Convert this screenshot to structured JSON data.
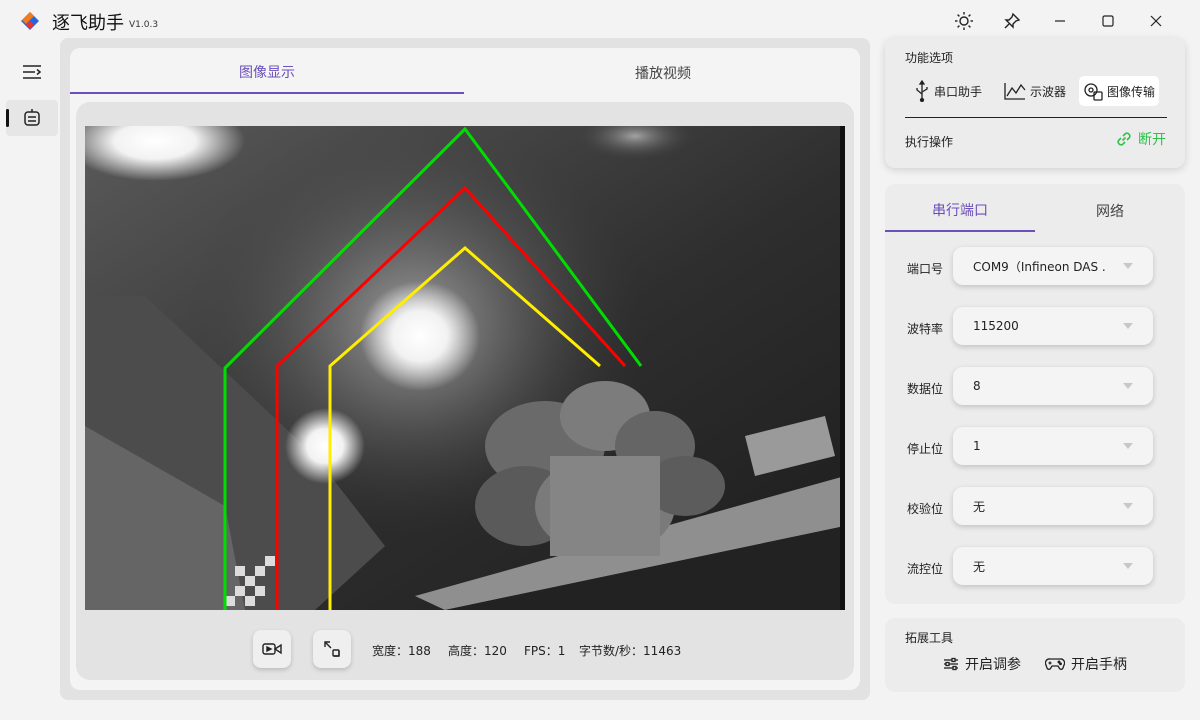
{
  "app": {
    "title": "逐飞助手",
    "version": "V1.0.3"
  },
  "content": {
    "tabs": [
      {
        "label": "图像显示",
        "active": true
      },
      {
        "label": "播放视频",
        "active": false
      }
    ],
    "stats": {
      "width_label": "宽度：",
      "width": "188",
      "height_label": "高度：",
      "height": "120",
      "fps_label": "FPS：",
      "fps": "1",
      "bytes_label": "字节数/秒：",
      "bytes": "11463"
    },
    "overlay_colors": {
      "outer": "#00dd00",
      "middle": "#ff0000",
      "inner": "#ffee00"
    }
  },
  "function_panel": {
    "title": "功能选项",
    "buttons": [
      {
        "label": "串口助手",
        "icon": "usb-icon",
        "active": false
      },
      {
        "label": "示波器",
        "icon": "oscilloscope-icon",
        "active": false
      },
      {
        "label": "图像传输",
        "icon": "image-transfer-icon",
        "active": true
      }
    ],
    "action_label": "执行操作",
    "disconnect_label": "断开"
  },
  "connection_panel": {
    "tabs": [
      {
        "label": "串行端口",
        "active": true
      },
      {
        "label": "网络",
        "active": false
      }
    ],
    "fields": [
      {
        "label": "端口号",
        "value": "COM9（Infineon DAS ."
      },
      {
        "label": "波特率",
        "value": "115200"
      },
      {
        "label": "数据位",
        "value": "8"
      },
      {
        "label": "停止位",
        "value": "1"
      },
      {
        "label": "校验位",
        "value": "无"
      },
      {
        "label": "流控位",
        "value": "无"
      }
    ]
  },
  "tools_panel": {
    "title": "拓展工具",
    "buttons": [
      {
        "label": "开启调参",
        "icon": "sliders-icon"
      },
      {
        "label": "开启手柄",
        "icon": "gamepad-icon"
      }
    ]
  },
  "colors": {
    "accent": "#6b4fbb",
    "connected": "#2ec24a"
  }
}
